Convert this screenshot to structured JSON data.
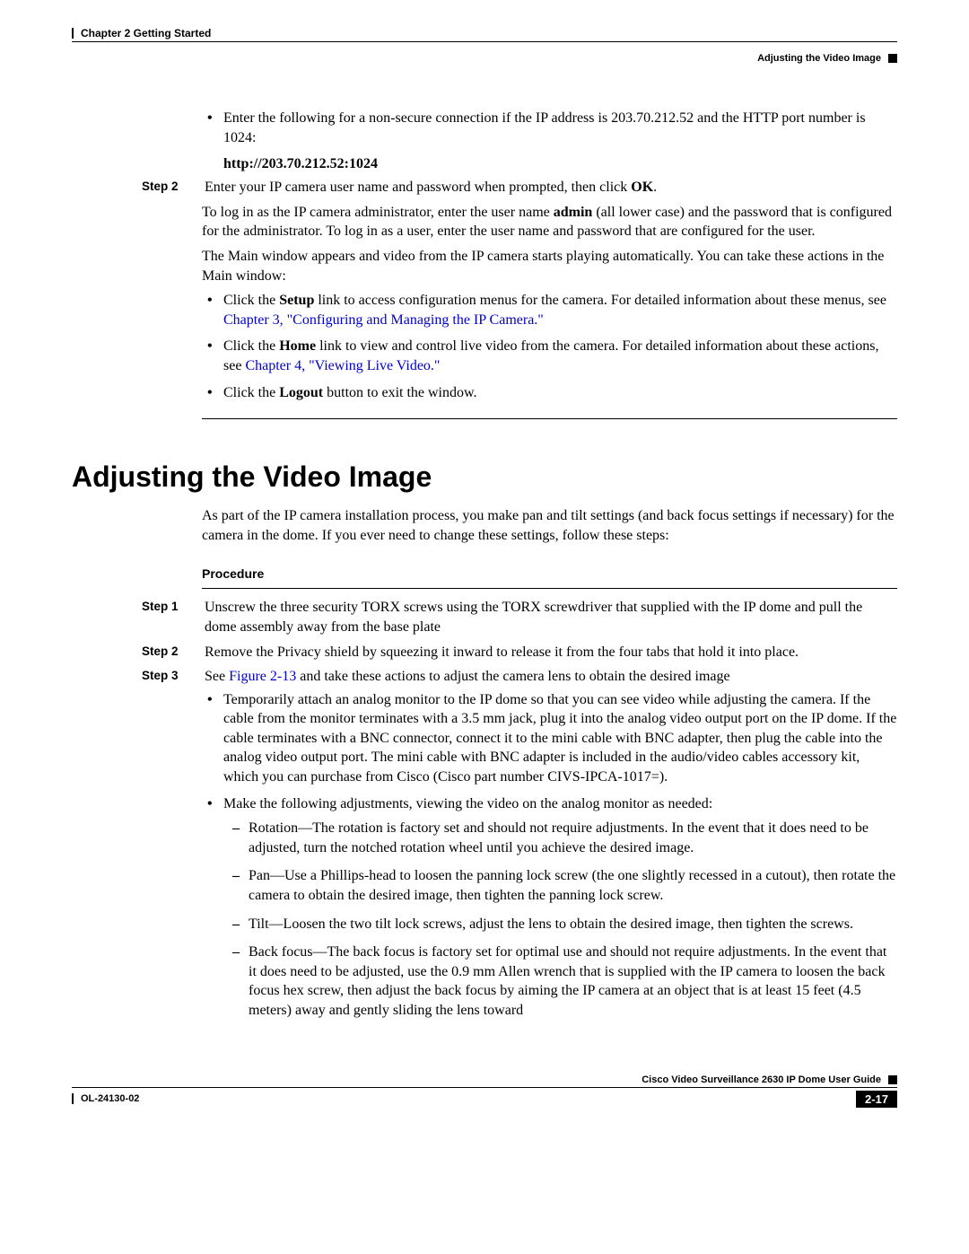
{
  "header": {
    "chapter": "Chapter 2      Getting Started",
    "topic": "Adjusting the Video Image"
  },
  "intro": {
    "bullet1": "Enter the following for a non-secure connection if the IP address is 203.70.212.52 and the HTTP port number is 1024:",
    "url": "http://203.70.212.52:1024"
  },
  "step2top": {
    "label": "Step 2",
    "text_a": "Enter your IP camera user name and password when prompted, then click ",
    "ok": "OK",
    "text_b": ".",
    "para2a": "To log in as the IP camera administrator, enter the user name ",
    "admin": "admin",
    "para2b": " (all lower case) and the password that is configured for the administrator. To log in as a user, enter the user name and password that are configured for the user.",
    "para3": "The Main window appears and video from the IP camera starts playing automatically. You can take these actions in the Main window:",
    "b1a": "Click the ",
    "b1setup": "Setup",
    "b1b": " link to access configuration menus for the camera. For detailed information about these menus, see ",
    "b1link": "Chapter 3, \"Configuring and Managing the IP Camera.\"",
    "b2a": "Click the ",
    "b2home": "Home",
    "b2b": " link to view and control live video from the camera. For detailed information about these actions, see ",
    "b2link": "Chapter 4, \"Viewing Live Video.\"",
    "b3a": "Click the ",
    "b3logout": "Logout",
    "b3b": " button to exit the window."
  },
  "section": {
    "title": "Adjusting the Video Image",
    "intro": "As part of the IP camera installation process, you make pan and tilt settings (and back focus settings if necessary) for the camera in the dome. If you ever need to change these settings, follow these steps:",
    "procedure": "Procedure"
  },
  "steps": {
    "s1": {
      "label": "Step 1",
      "text": "Unscrew the three security TORX screws using the TORX screwdriver that supplied with the IP dome and pull the dome assembly away from the base plate"
    },
    "s2": {
      "label": "Step 2",
      "text": "Remove the Privacy shield by squeezing it inward to release it from the four tabs that hold it into place."
    },
    "s3": {
      "label": "Step 3",
      "text_a": "See ",
      "figlink": "Figure 2-13",
      "text_b": " and take these actions to adjust the camera lens to obtain the desired image",
      "b1": "Temporarily attach an analog monitor to the IP dome so that you can see video while adjusting the camera. If the cable from the monitor terminates with a 3.5 mm jack, plug it into the analog video output port on the IP dome. If the cable terminates with a BNC connector, connect it to the mini cable with BNC adapter, then plug the cable into the analog video output port. The mini cable with BNC adapter is included in the audio/video cables accessory kit, which you can purchase from Cisco (Cisco part number CIVS-IPCA-1017=).",
      "b2": "Make the following adjustments, viewing the video on the analog monitor as needed:",
      "d1": "Rotation—The rotation is factory set and should not require adjustments. In the event that it does need to be adjusted, turn the notched rotation wheel until you achieve the desired image.",
      "d2": "Pan—Use a Phillips-head to loosen the panning lock screw (the one slightly recessed in a cutout), then rotate the camera to obtain the desired image, then tighten the panning lock screw.",
      "d3": "Tilt—Loosen the two tilt lock screws, adjust the lens to obtain the desired image, then tighten the screws.",
      "d4": "Back focus—The back focus is factory set for optimal use and should not require adjustments. In the event that it does need to be adjusted, use the 0.9 mm Allen wrench that is supplied with the IP camera to loosen the back focus hex screw, then adjust the back focus by aiming the IP camera at an object that is at least 15 feet (4.5 meters) away and gently sliding the lens toward"
    }
  },
  "footer": {
    "guide": "Cisco Video Surveillance 2630 IP Dome User Guide",
    "doc": "OL-24130-02",
    "page": "2-17"
  }
}
